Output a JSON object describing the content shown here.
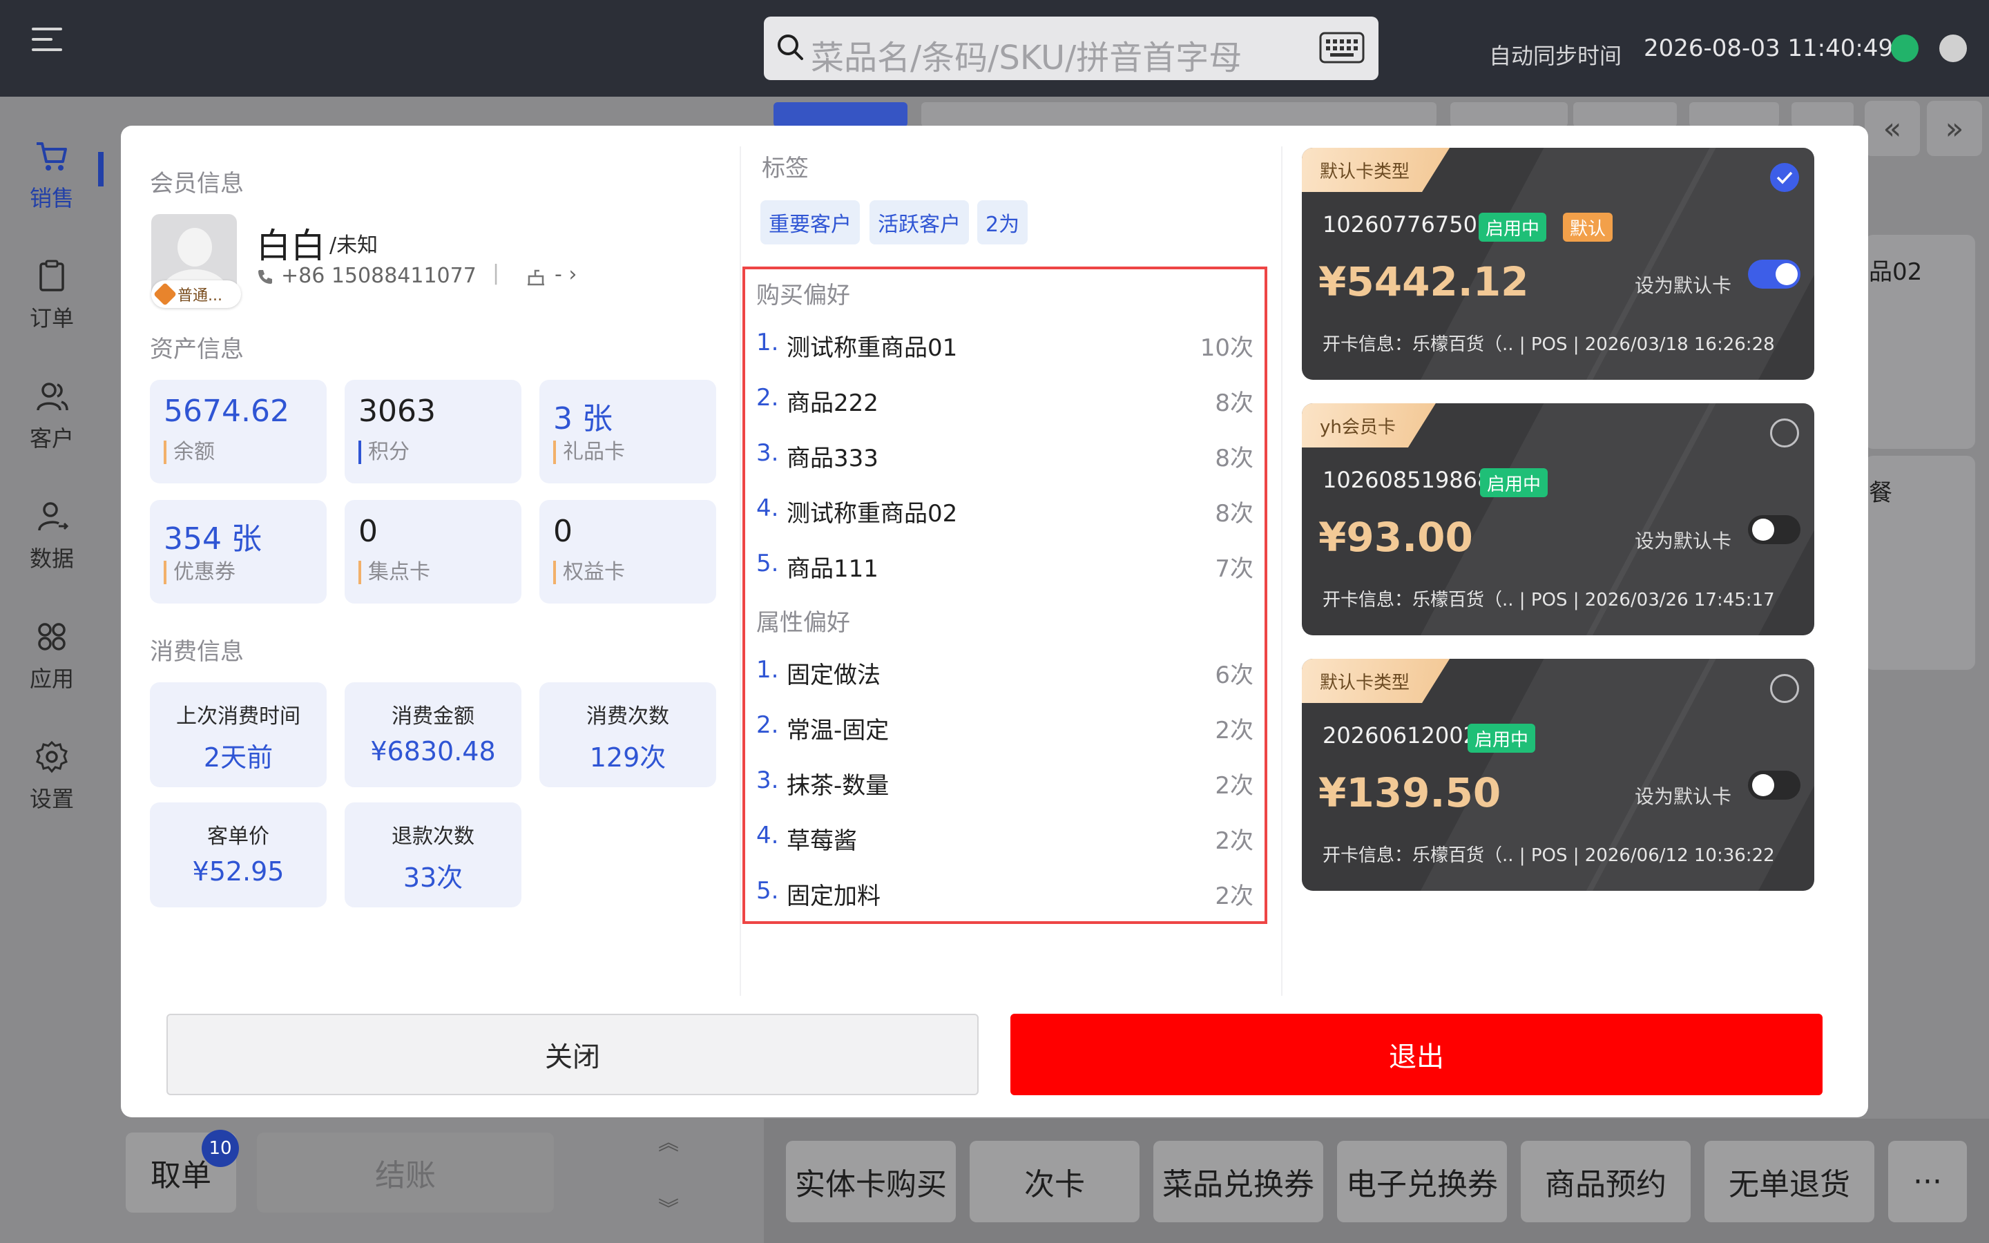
{
  "topbar": {
    "search_placeholder": "菜品名/条码/SKU/拼音首字母",
    "sync_label": "自动同步时间",
    "datetime": "2026-08-03 11:40:49"
  },
  "sidebar": {
    "items": [
      {
        "label": "销售",
        "icon": "cart-icon",
        "active": true
      },
      {
        "label": "订单",
        "icon": "clipboard-icon"
      },
      {
        "label": "客户",
        "icon": "users-icon"
      },
      {
        "label": "数据",
        "icon": "user-data-icon"
      },
      {
        "label": "应用",
        "icon": "apps-icon"
      },
      {
        "label": "设置",
        "icon": "gear-icon"
      }
    ]
  },
  "background": {
    "right_items": [
      "品02",
      "餐"
    ],
    "bottom_buttons": [
      "实体卡购买",
      "次卡",
      "菜品兑换券",
      "电子兑换券",
      "商品预约",
      "无单退货",
      "···"
    ],
    "pickup_label": "取单",
    "pickup_badge": "10",
    "checkout_label": "结账"
  },
  "member": {
    "section_title": "会员信息",
    "name": "白白",
    "gender": "/未知",
    "phone": "+86 15088411077",
    "separator": "|",
    "store": "- ›",
    "level_badge": "普通..."
  },
  "assets": {
    "section_title": "资产信息",
    "tiles": [
      {
        "value": "5674.62",
        "label": "余额"
      },
      {
        "value": "3063",
        "label": "积分"
      },
      {
        "value": "3 张",
        "label": "礼品卡"
      },
      {
        "value": "354 张",
        "label": "优惠券"
      },
      {
        "value": "0",
        "label": "集点卡"
      },
      {
        "value": "0",
        "label": "权益卡"
      }
    ]
  },
  "consumption": {
    "section_title": "消费信息",
    "tiles": [
      {
        "label": "上次消费时间",
        "value": "2天前"
      },
      {
        "label": "消费金额",
        "value": "¥6830.48"
      },
      {
        "label": "消费次数",
        "value": "129次"
      },
      {
        "label": "客单价",
        "value": "¥52.95"
      },
      {
        "label": "退款次数",
        "value": "33次"
      }
    ]
  },
  "tags": {
    "section_title": "标签",
    "items": [
      "重要客户",
      "活跃客户",
      "2为"
    ]
  },
  "purchase_pref": {
    "title": "购买偏好",
    "items": [
      {
        "idx": "1.",
        "name": "测试称重商品01",
        "count": "10次"
      },
      {
        "idx": "2.",
        "name": "商品222",
        "count": "8次"
      },
      {
        "idx": "3.",
        "name": "商品333",
        "count": "8次"
      },
      {
        "idx": "4.",
        "name": "测试称重商品02",
        "count": "8次"
      },
      {
        "idx": "5.",
        "name": "商品111",
        "count": "7次"
      }
    ]
  },
  "attr_pref": {
    "title": "属性偏好",
    "items": [
      {
        "idx": "1.",
        "name": "固定做法",
        "count": "6次"
      },
      {
        "idx": "2.",
        "name": "常温-固定",
        "count": "2次"
      },
      {
        "idx": "3.",
        "name": "抹茶-数量",
        "count": "2次"
      },
      {
        "idx": "4.",
        "name": "草莓酱",
        "count": "2次"
      },
      {
        "idx": "5.",
        "name": "固定加料",
        "count": "2次"
      }
    ]
  },
  "cards": [
    {
      "type": "默认卡类型",
      "number": "102607767503",
      "status": "启用中",
      "default_tag": "默认",
      "amount": "¥5442.12",
      "set_default_label": "设为默认卡",
      "toggle_on": true,
      "selected": true,
      "info": "开卡信息：乐檬百货（.. | POS | 2026/03/18 16:26:28"
    },
    {
      "type": "yh会员卡",
      "number": "102608519868",
      "status": "启用中",
      "amount": "¥93.00",
      "set_default_label": "设为默认卡",
      "toggle_on": false,
      "selected": false,
      "info": "开卡信息：乐檬百货（.. | POS | 2026/03/26 17:45:17"
    },
    {
      "type": "默认卡类型",
      "number": "20260612002",
      "status": "启用中",
      "amount": "¥139.50",
      "set_default_label": "设为默认卡",
      "toggle_on": false,
      "selected": false,
      "info": "开卡信息：乐檬百货（.. | POS | 2026/06/12 10:36:22"
    }
  ],
  "actions": {
    "close_label": "关闭",
    "exit_label": "退出"
  },
  "colors": {
    "accent_blue": "#2f55d4",
    "exit_red": "#ff0000",
    "status_green": "#1fbf77",
    "highlight_border": "#ee4545"
  }
}
